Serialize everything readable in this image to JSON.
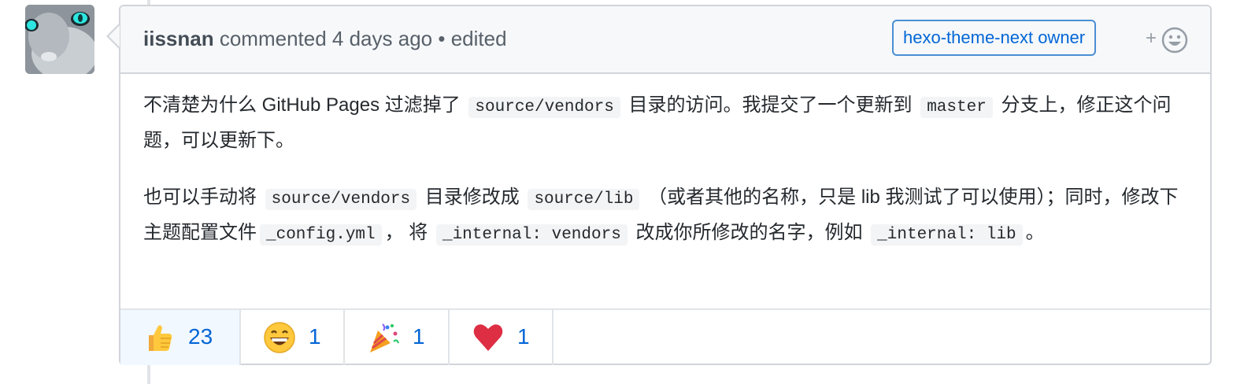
{
  "comment": {
    "author": "iissnan",
    "action": "commented",
    "time": "4 days ago",
    "separator": "•",
    "edited": "edited",
    "badge": "hexo-theme-next owner",
    "add_reaction": "+",
    "paragraphs": {
      "p1": {
        "t1": "不清楚为什么 GitHub Pages 过滤掉了",
        "c1": "source/vendors",
        "t2": "目录的访问。我提交了一个更新到",
        "c2": "master",
        "t3": "分支上，修正这个问题，可以更新下。"
      },
      "p2": {
        "t1": "也可以手动将",
        "c1": "source/vendors",
        "t2": "目录修改成",
        "c2": "source/lib",
        "t3": "（或者其他的名称，只是 lib 我测试了可以使用）；同时，修改下主题配置文件",
        "c3": "_config.yml",
        "t4": "， 将",
        "c4": "_internal: vendors",
        "t5": "改成你所修改的名字，例如",
        "c5": "_internal: lib",
        "t6": "。"
      }
    },
    "reactions": [
      {
        "icon": "thumbs-up-icon",
        "count": "23",
        "active": true
      },
      {
        "icon": "smile-icon",
        "count": "1",
        "active": false
      },
      {
        "icon": "tada-icon",
        "count": "1",
        "active": false
      },
      {
        "icon": "heart-icon",
        "count": "1",
        "active": false
      }
    ]
  },
  "colors": {
    "link": "#0366d6",
    "border": "#d1d5da",
    "header_bg": "#f6f8fa",
    "active_reaction_bg": "#f1f8ff"
  }
}
